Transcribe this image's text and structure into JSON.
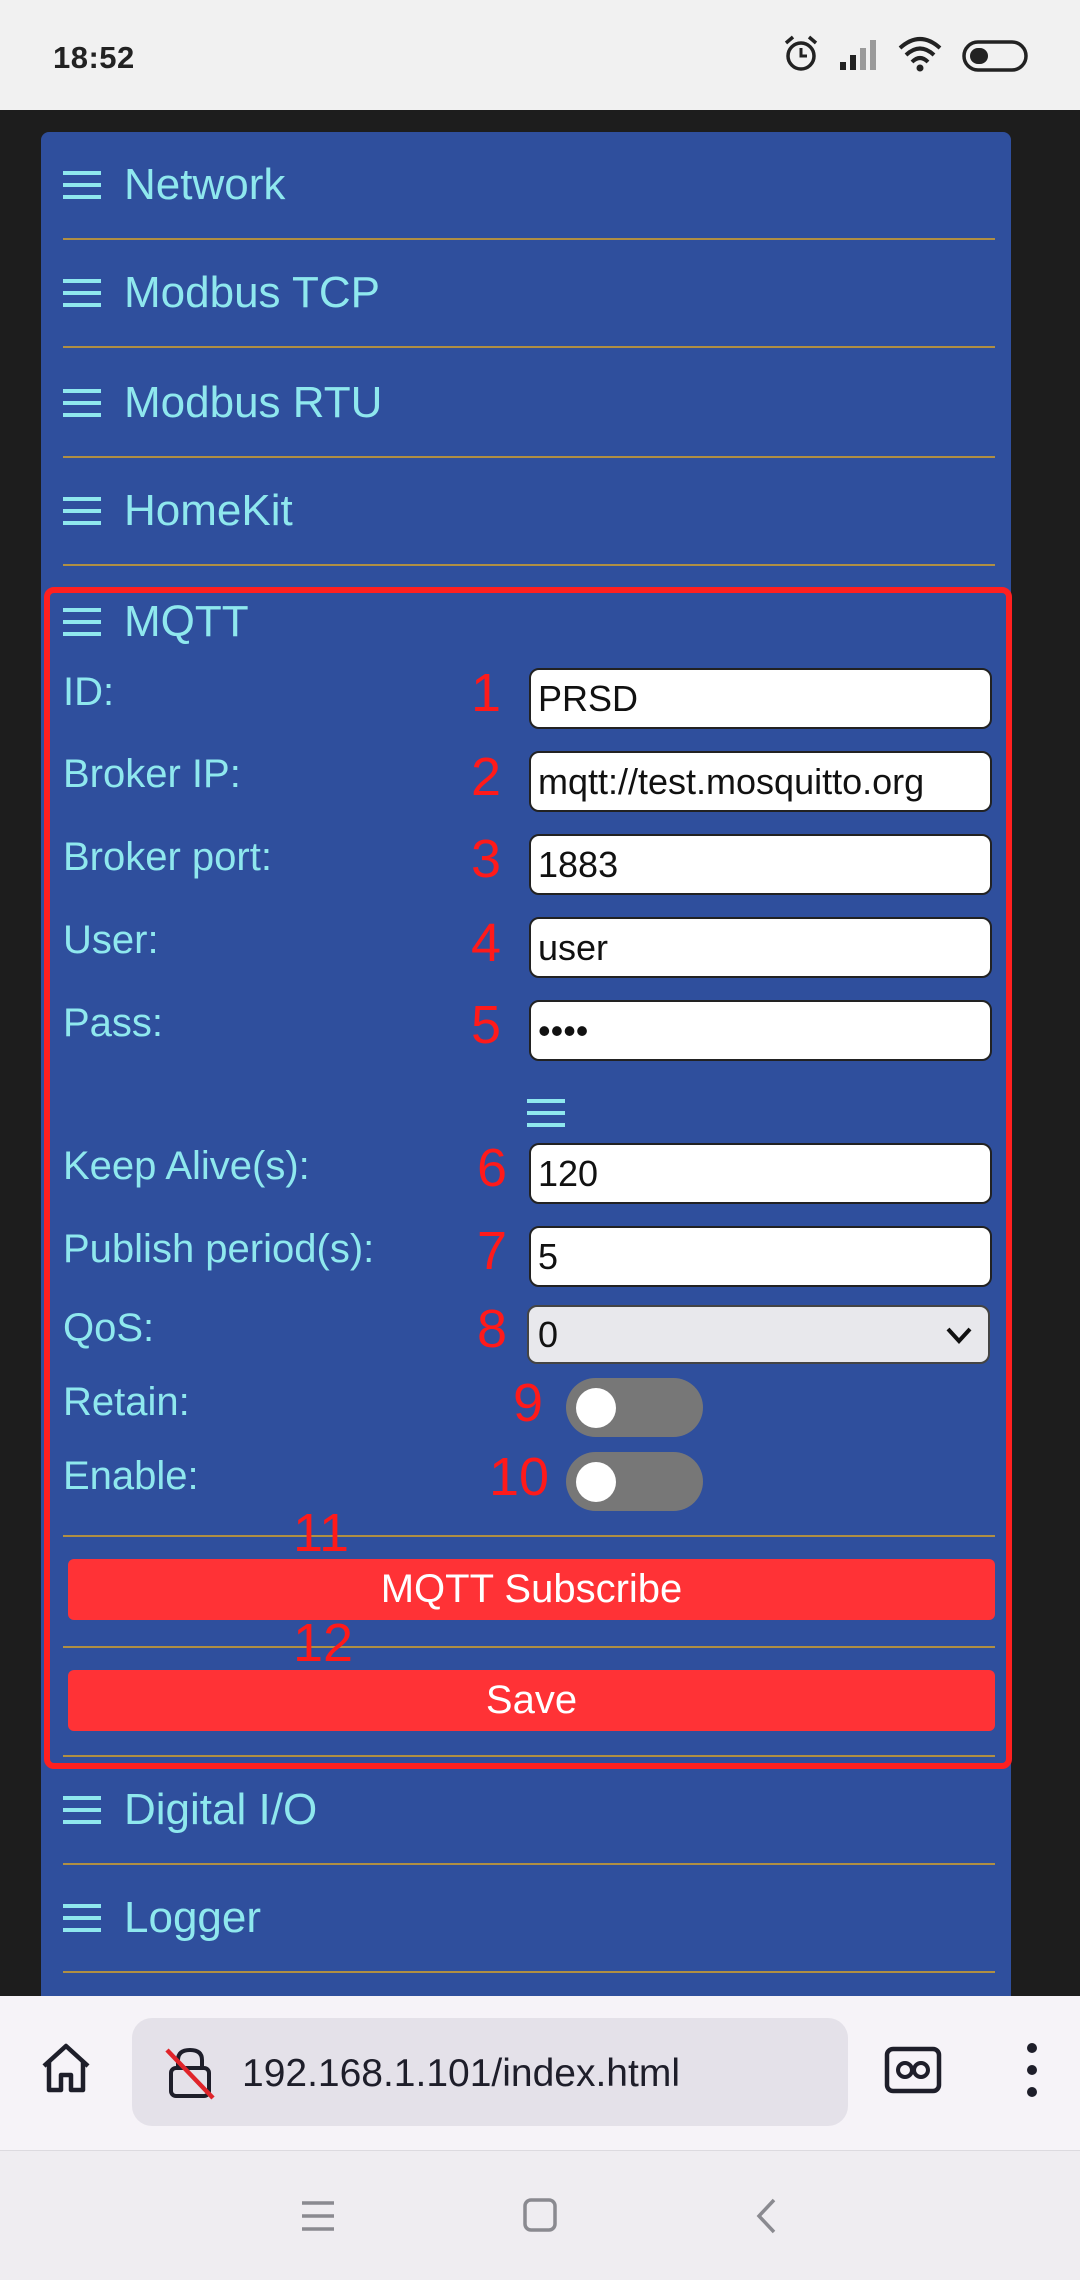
{
  "status_bar": {
    "time": "18:52"
  },
  "menu": {
    "items_top": [
      "Network",
      "Modbus TCP",
      "Modbus RTU",
      "HomeKit"
    ],
    "mqtt_title": "MQTT",
    "items_bottom": [
      "Digital I/O",
      "Logger"
    ]
  },
  "mqtt": {
    "fields": [
      {
        "num": "1",
        "label": "ID:",
        "value": "PRSD"
      },
      {
        "num": "2",
        "label": "Broker IP:",
        "value": "mqtt://test.mosquitto.org"
      },
      {
        "num": "3",
        "label": "Broker port:",
        "value": "1883"
      },
      {
        "num": "4",
        "label": "User:",
        "value": "user"
      },
      {
        "num": "5",
        "label": "Pass:",
        "value": "••••"
      },
      {
        "num": "6",
        "label": "Keep Alive(s):",
        "value": "120"
      },
      {
        "num": "7",
        "label": "Publish period(s):",
        "value": "5"
      }
    ],
    "qos": {
      "num": "8",
      "label": "QoS:",
      "value": "0"
    },
    "retain": {
      "num": "9",
      "label": "Retain:",
      "on": false
    },
    "enable": {
      "num": "10",
      "label": "Enable:",
      "on": false
    },
    "subscribe": {
      "num": "11",
      "label": "MQTT Subscribe"
    },
    "save": {
      "num": "12",
      "label": "Save"
    },
    "accent_color": "#ff1a1a"
  },
  "browser": {
    "url": "192.168.1.101/index.html"
  }
}
